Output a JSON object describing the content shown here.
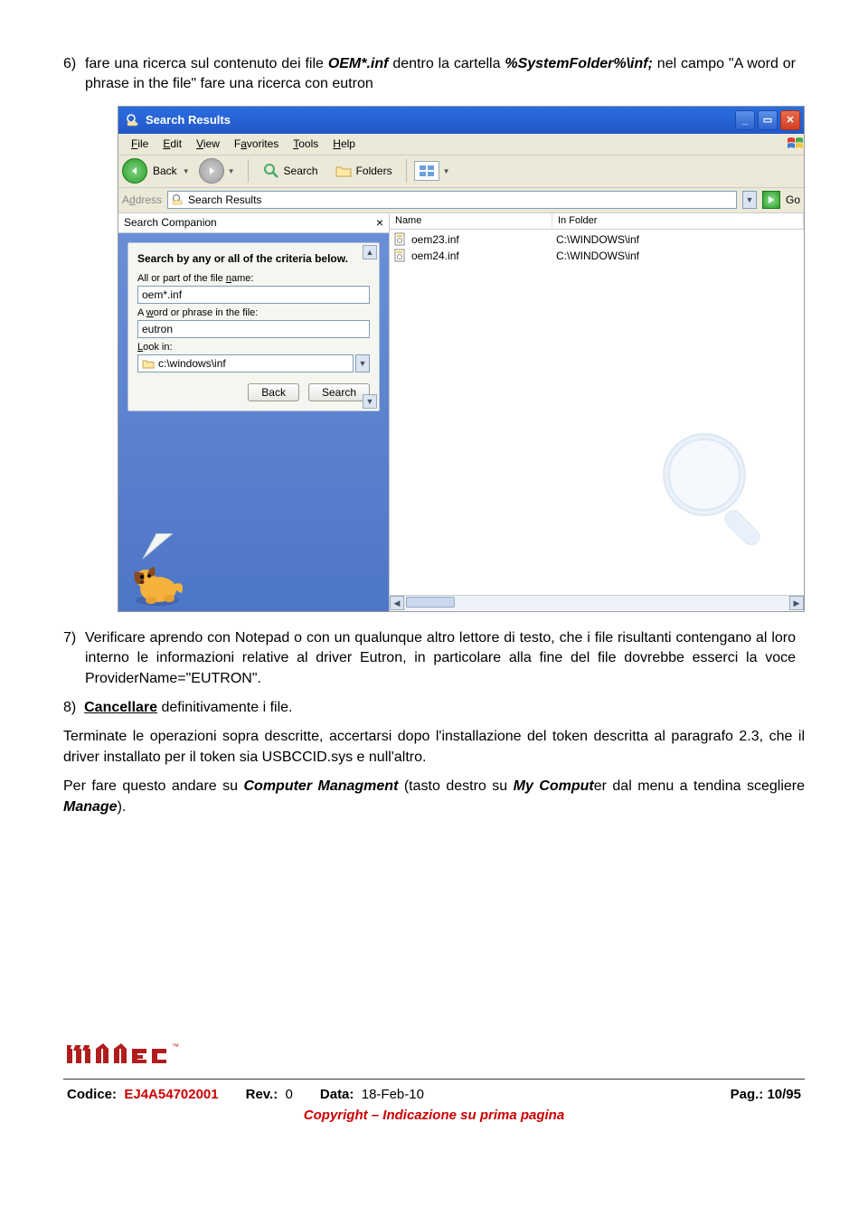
{
  "text": {
    "item6_prefix": "6)  fare una ricerca sul contenuto dei file ",
    "item6_oem": "OEM*.inf",
    "item6_mid": " dentro la cartella ",
    "item6_path": "%SystemFolder%\\inf;",
    "item6_post": " nel campo \"A word or phrase in the file\" fare una ricerca con eutron",
    "item7_prefix": "7)  Verificare aprendo con Notepad o con un qualunque altro lettore di testo, che i file risultanti contengano al loro interno le informazioni relative al driver Eutron, in particolare alla fine del file dovrebbe esserci la voce ProviderName=\"EUTRON\".",
    "item8_prefix": "8)  ",
    "item8_cancel": "Cancellare",
    "item8_post": " definitivamente i file.",
    "term_p1": "Terminate le operazioni sopra descritte, accertarsi dopo l'installazione del token descritta al paragrafo 2.3, che il driver installato per il token sia USBCCID.sys e null'altro.",
    "term_p2a": "Per fare questo andare su ",
    "term_cm": "Computer Managment",
    "term_p2b": " (tasto destro su ",
    "term_mc": "My Comput",
    "term_p2c": "er dal menu a tendina scegliere ",
    "term_mg": "Manage",
    "term_p2d": ")."
  },
  "window": {
    "title": "Search Results",
    "menus": [
      "File",
      "Edit",
      "View",
      "Favorites",
      "Tools",
      "Help"
    ],
    "menus_u": [
      "F",
      "E",
      "V",
      "a",
      "T",
      "H"
    ],
    "back": "Back",
    "search": "Search",
    "folders": "Folders",
    "address_label": "Address",
    "address_text": "Search Results",
    "go": "Go",
    "companion": "Search Companion",
    "panel_hd": "Search by any or all of the criteria below.",
    "lab_name": "All or part of the file name:",
    "val_name": "oem*.inf",
    "lab_phrase": "A word or phrase in the file:",
    "val_phrase": "eutron",
    "lab_look": "Look in:",
    "val_look": "c:\\windows\\inf",
    "btn_back": "Back",
    "btn_search": "Search",
    "col_name": "Name",
    "col_folder": "In Folder",
    "files": [
      {
        "name": "oem23.inf",
        "folder": "C:\\WINDOWS\\inf"
      },
      {
        "name": "oem24.inf",
        "folder": "C:\\WINDOWS\\inf"
      }
    ]
  },
  "footer": {
    "codice_lbl": "Codice:",
    "codice_val": "EJ4A54702001",
    "rev_lbl": "Rev.:",
    "rev_val": "0",
    "data_lbl": "Data:",
    "data_val": "18-Feb-10",
    "pag_lbl": "Pag.:",
    "pag_val": "10/95",
    "copyright": "Copyright – Indicazione su prima pagina"
  }
}
